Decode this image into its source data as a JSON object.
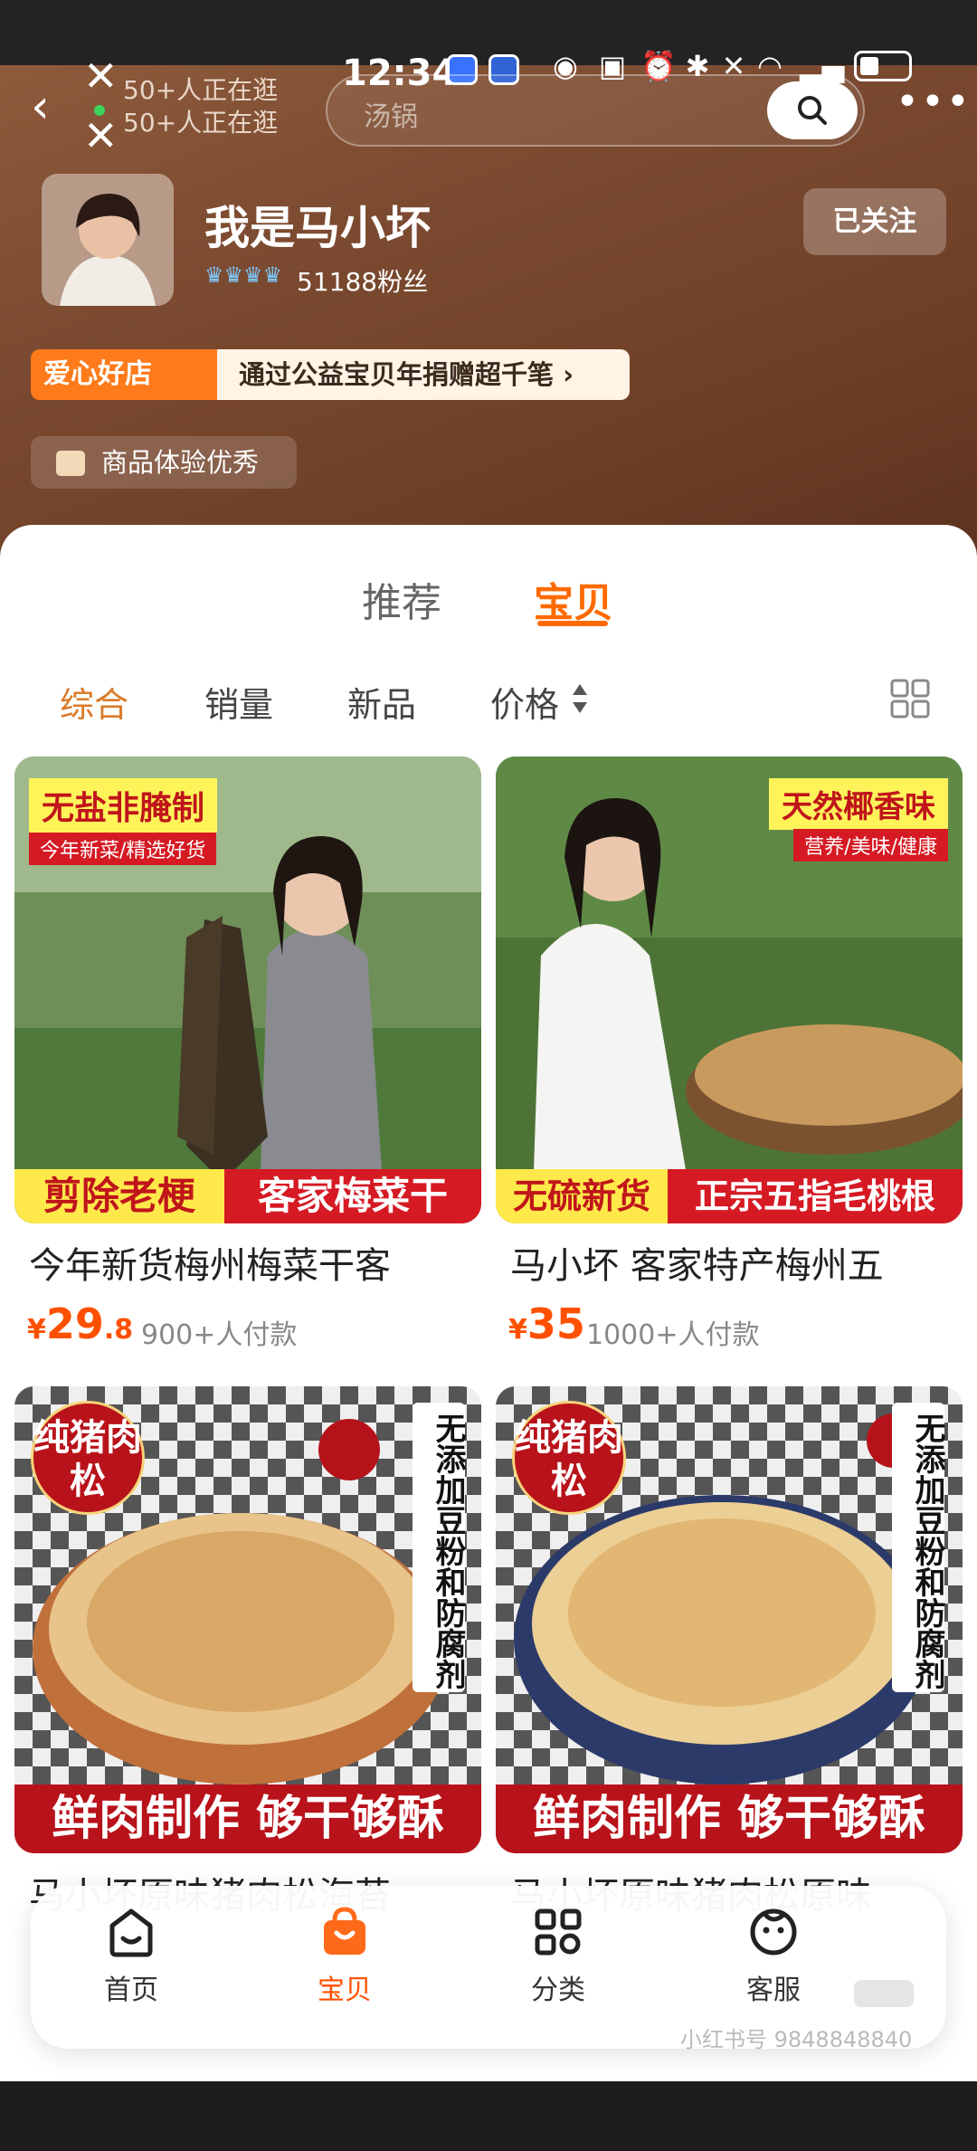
{
  "status_bar": {
    "time": "12:34"
  },
  "header": {
    "live_ticker": [
      "50+人正在逛",
      "50+人正在逛"
    ],
    "search_placeholder": "汤锅"
  },
  "shop": {
    "name": "我是马小坏",
    "fans": "51188粉丝",
    "follow_label": "已关注",
    "charity_tag": "爱心好店",
    "charity_text": "通过公益宝贝年捐赠超千笔 ›",
    "experience_tag": "商品体验优秀"
  },
  "tabs": [
    {
      "label": "推荐",
      "active": false
    },
    {
      "label": "宝贝",
      "active": true
    }
  ],
  "sort": {
    "items": [
      "综合",
      "销量",
      "新品",
      "价格"
    ],
    "active": "综合"
  },
  "products": [
    {
      "badge_top": "无盐非腌制",
      "badge_sub": "今年新菜/精选好货",
      "strip_left": "剪除老梗",
      "strip_right": "客家梅菜干",
      "title": "今年新货梅州梅菜干客",
      "price_symbol": "¥",
      "price_main": "29",
      "price_decimal": ".8",
      "sold": "900+人付款"
    },
    {
      "badge_top": "天然椰香味",
      "badge_sub": "营养/美味/健康",
      "strip_left": "无硫新货",
      "strip_right": "正宗五指毛桃根",
      "title": "马小坏 客家特产梅州五",
      "price_symbol": "¥",
      "price_main": "35",
      "price_decimal": "",
      "sold": "1000+人付款"
    },
    {
      "circle_badge": "纯猪肉松",
      "vertical_badge": "无添加豆粉和防腐剂",
      "strip": "鲜肉制作 够干够酥",
      "title": "马小坏原味猪肉松海苔"
    },
    {
      "circle_badge": "纯猪肉松",
      "vertical_badge": "无添加豆粉和防腐剂",
      "strip": "鲜肉制作 够干够酥",
      "title": "马小坏原味猪肉松原味"
    }
  ],
  "tabbar": [
    {
      "label": "首页",
      "icon": "home-icon",
      "active": false
    },
    {
      "label": "宝贝",
      "icon": "bag-icon",
      "active": true
    },
    {
      "label": "分类",
      "icon": "category-icon",
      "active": false
    },
    {
      "label": "客服",
      "icon": "service-icon",
      "active": false
    }
  ],
  "watermark": "小红书号 9848848840",
  "colors": {
    "accent": "#ff6a00",
    "price": "#ff5000",
    "hero": "#7b4a30"
  }
}
